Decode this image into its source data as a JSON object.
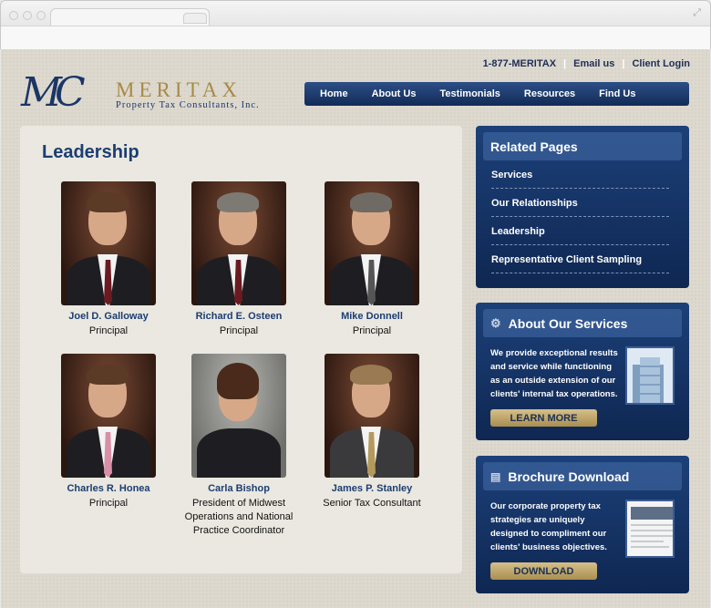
{
  "toplinks": {
    "phone": "1-877-MERITAX",
    "email": "Email us",
    "login": "Client Login"
  },
  "logo": {
    "mark": "MC",
    "name": "MERITAX",
    "tagline": "Property Tax Consultants, Inc."
  },
  "nav": [
    "Home",
    "About Us",
    "Testimonials",
    "Resources",
    "Find Us"
  ],
  "content": {
    "heading": "Leadership",
    "people": [
      {
        "name": "Joel D. Galloway",
        "title": "Principal"
      },
      {
        "name": "Richard E. Osteen",
        "title": "Principal"
      },
      {
        "name": "Mike Donnell",
        "title": "Principal"
      },
      {
        "name": "Charles R. Honea",
        "title": "Principal"
      },
      {
        "name": "Carla Bishop",
        "title": "President of Midwest Operations and National Practice Coordinator"
      },
      {
        "name": "James P. Stanley",
        "title": "Senior Tax Consultant"
      }
    ]
  },
  "related": {
    "heading": "Related Pages",
    "items": [
      "Services",
      "Our Relationships",
      "Leadership",
      "Representative Client Sampling"
    ]
  },
  "services": {
    "heading": "About Our Services",
    "body": "We provide exceptional results and service while functioning as an outside extension of our clients' internal tax operations.",
    "button": "LEARN MORE"
  },
  "brochure": {
    "heading": "Brochure Download",
    "body": "Our corporate property tax strategies are uniquely designed to compliment our clients' business objectives.",
    "button": "DOWNLOAD"
  }
}
